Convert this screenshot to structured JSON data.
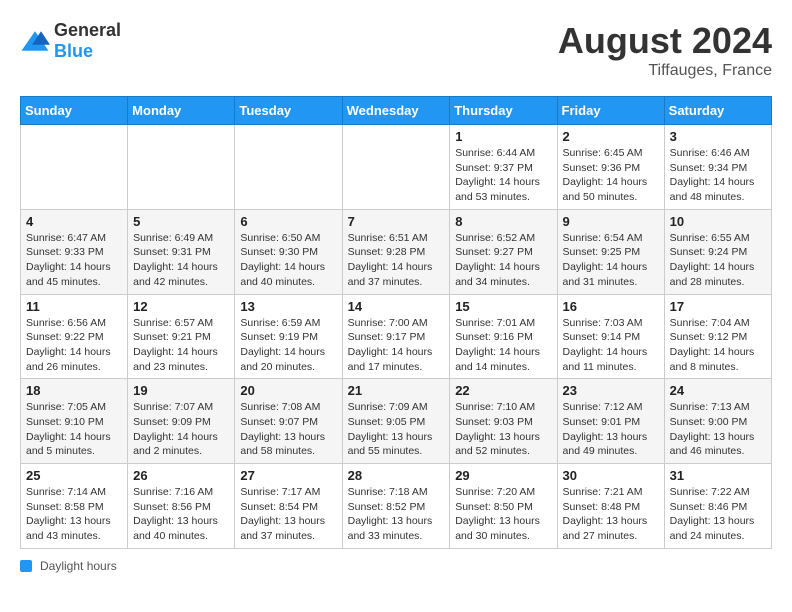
{
  "header": {
    "logo_general": "General",
    "logo_blue": "Blue",
    "month_year": "August 2024",
    "location": "Tiffauges, France"
  },
  "calendar": {
    "weekdays": [
      "Sunday",
      "Monday",
      "Tuesday",
      "Wednesday",
      "Thursday",
      "Friday",
      "Saturday"
    ],
    "weeks": [
      [
        {
          "day": "",
          "detail": ""
        },
        {
          "day": "",
          "detail": ""
        },
        {
          "day": "",
          "detail": ""
        },
        {
          "day": "",
          "detail": ""
        },
        {
          "day": "1",
          "detail": "Sunrise: 6:44 AM\nSunset: 9:37 PM\nDaylight: 14 hours and 53 minutes."
        },
        {
          "day": "2",
          "detail": "Sunrise: 6:45 AM\nSunset: 9:36 PM\nDaylight: 14 hours and 50 minutes."
        },
        {
          "day": "3",
          "detail": "Sunrise: 6:46 AM\nSunset: 9:34 PM\nDaylight: 14 hours and 48 minutes."
        }
      ],
      [
        {
          "day": "4",
          "detail": "Sunrise: 6:47 AM\nSunset: 9:33 PM\nDaylight: 14 hours and 45 minutes."
        },
        {
          "day": "5",
          "detail": "Sunrise: 6:49 AM\nSunset: 9:31 PM\nDaylight: 14 hours and 42 minutes."
        },
        {
          "day": "6",
          "detail": "Sunrise: 6:50 AM\nSunset: 9:30 PM\nDaylight: 14 hours and 40 minutes."
        },
        {
          "day": "7",
          "detail": "Sunrise: 6:51 AM\nSunset: 9:28 PM\nDaylight: 14 hours and 37 minutes."
        },
        {
          "day": "8",
          "detail": "Sunrise: 6:52 AM\nSunset: 9:27 PM\nDaylight: 14 hours and 34 minutes."
        },
        {
          "day": "9",
          "detail": "Sunrise: 6:54 AM\nSunset: 9:25 PM\nDaylight: 14 hours and 31 minutes."
        },
        {
          "day": "10",
          "detail": "Sunrise: 6:55 AM\nSunset: 9:24 PM\nDaylight: 14 hours and 28 minutes."
        }
      ],
      [
        {
          "day": "11",
          "detail": "Sunrise: 6:56 AM\nSunset: 9:22 PM\nDaylight: 14 hours and 26 minutes."
        },
        {
          "day": "12",
          "detail": "Sunrise: 6:57 AM\nSunset: 9:21 PM\nDaylight: 14 hours and 23 minutes."
        },
        {
          "day": "13",
          "detail": "Sunrise: 6:59 AM\nSunset: 9:19 PM\nDaylight: 14 hours and 20 minutes."
        },
        {
          "day": "14",
          "detail": "Sunrise: 7:00 AM\nSunset: 9:17 PM\nDaylight: 14 hours and 17 minutes."
        },
        {
          "day": "15",
          "detail": "Sunrise: 7:01 AM\nSunset: 9:16 PM\nDaylight: 14 hours and 14 minutes."
        },
        {
          "day": "16",
          "detail": "Sunrise: 7:03 AM\nSunset: 9:14 PM\nDaylight: 14 hours and 11 minutes."
        },
        {
          "day": "17",
          "detail": "Sunrise: 7:04 AM\nSunset: 9:12 PM\nDaylight: 14 hours and 8 minutes."
        }
      ],
      [
        {
          "day": "18",
          "detail": "Sunrise: 7:05 AM\nSunset: 9:10 PM\nDaylight: 14 hours and 5 minutes."
        },
        {
          "day": "19",
          "detail": "Sunrise: 7:07 AM\nSunset: 9:09 PM\nDaylight: 14 hours and 2 minutes."
        },
        {
          "day": "20",
          "detail": "Sunrise: 7:08 AM\nSunset: 9:07 PM\nDaylight: 13 hours and 58 minutes."
        },
        {
          "day": "21",
          "detail": "Sunrise: 7:09 AM\nSunset: 9:05 PM\nDaylight: 13 hours and 55 minutes."
        },
        {
          "day": "22",
          "detail": "Sunrise: 7:10 AM\nSunset: 9:03 PM\nDaylight: 13 hours and 52 minutes."
        },
        {
          "day": "23",
          "detail": "Sunrise: 7:12 AM\nSunset: 9:01 PM\nDaylight: 13 hours and 49 minutes."
        },
        {
          "day": "24",
          "detail": "Sunrise: 7:13 AM\nSunset: 9:00 PM\nDaylight: 13 hours and 46 minutes."
        }
      ],
      [
        {
          "day": "25",
          "detail": "Sunrise: 7:14 AM\nSunset: 8:58 PM\nDaylight: 13 hours and 43 minutes."
        },
        {
          "day": "26",
          "detail": "Sunrise: 7:16 AM\nSunset: 8:56 PM\nDaylight: 13 hours and 40 minutes."
        },
        {
          "day": "27",
          "detail": "Sunrise: 7:17 AM\nSunset: 8:54 PM\nDaylight: 13 hours and 37 minutes."
        },
        {
          "day": "28",
          "detail": "Sunrise: 7:18 AM\nSunset: 8:52 PM\nDaylight: 13 hours and 33 minutes."
        },
        {
          "day": "29",
          "detail": "Sunrise: 7:20 AM\nSunset: 8:50 PM\nDaylight: 13 hours and 30 minutes."
        },
        {
          "day": "30",
          "detail": "Sunrise: 7:21 AM\nSunset: 8:48 PM\nDaylight: 13 hours and 27 minutes."
        },
        {
          "day": "31",
          "detail": "Sunrise: 7:22 AM\nSunset: 8:46 PM\nDaylight: 13 hours and 24 minutes."
        }
      ]
    ]
  },
  "footer": {
    "legend_label": "Daylight hours"
  }
}
